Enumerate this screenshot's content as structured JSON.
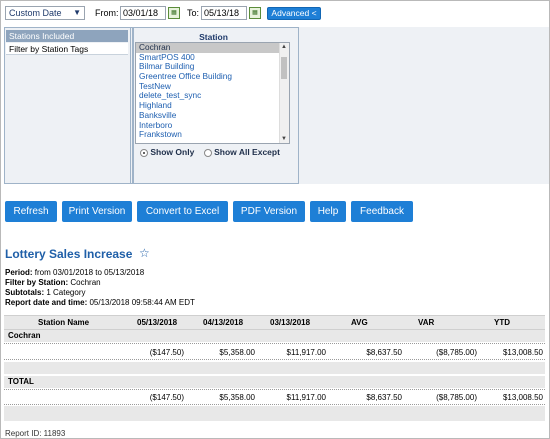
{
  "filters": {
    "range_select": "Custom Date",
    "from_label": "From:",
    "from_value": "03/01/18",
    "to_label": "To:",
    "to_value": "05/13/18",
    "advanced_label": "Advanced <"
  },
  "panel": {
    "tabs": [
      "Stations Included",
      "Filter by Station Tags"
    ],
    "station_header": "Station",
    "stations": [
      "Cochran",
      "SmartPOS 400",
      "Bilmar Building",
      "Greentree Office Building",
      "TestNew",
      "delete_test_sync",
      "Highland",
      "Banksville",
      "Interboro",
      "Frankstown"
    ],
    "radio_show_only": "Show Only",
    "radio_show_all_except": "Show All Except"
  },
  "actions": [
    "Refresh",
    "Print Version",
    "Convert to Excel",
    "PDF Version",
    "Help",
    "Feedback"
  ],
  "report": {
    "title": "Lottery Sales Increase",
    "period_label": "Period:",
    "period_value": "from 03/01/2018 to 05/13/2018",
    "filter_label": "Filter by Station:",
    "filter_value": "Cochran",
    "subtotals_label": "Subtotals:",
    "subtotals_value": "1 Category",
    "datetime_label": "Report date and time:",
    "datetime_value": "05/13/2018 09:58:44 AM EDT",
    "columns": [
      "Station Name",
      "05/13/2018",
      "04/13/2018",
      "03/13/2018",
      "AVG",
      "VAR",
      "YTD"
    ],
    "group_label": "Cochran",
    "row_values": [
      "($147.50)",
      "$5,358.00",
      "$11,917.00",
      "$8,637.50",
      "($8,785.00)",
      "$13,008.50"
    ],
    "total_label": "TOTAL",
    "total_values": [
      "($147.50)",
      "$5,358.00",
      "$11,917.00",
      "$8,637.50",
      "($8,785.00)",
      "$13,008.50"
    ],
    "report_id": "Report ID: 11893"
  }
}
